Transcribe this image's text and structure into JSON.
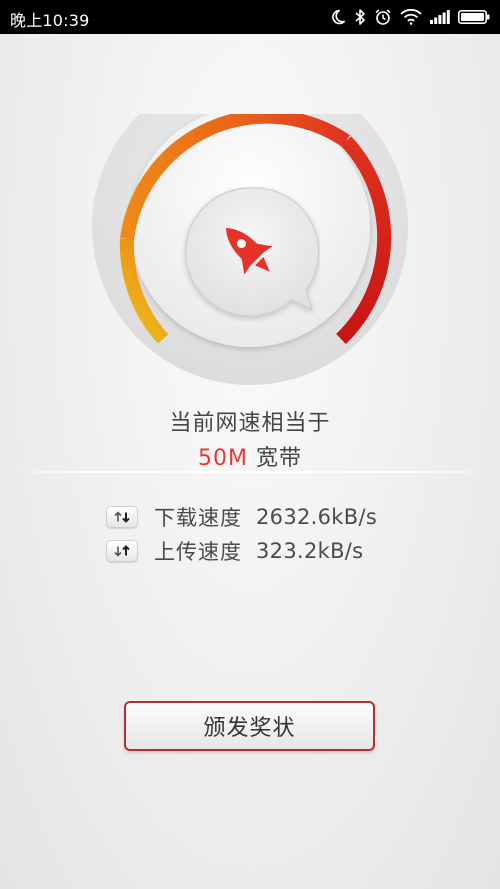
{
  "status_bar": {
    "time": "晚上10:39",
    "icons": [
      "moon-icon",
      "bluetooth-icon",
      "alarm-icon",
      "wifi-icon",
      "signal-icon",
      "battery-icon"
    ]
  },
  "gauge": {
    "icon": "rocket-icon",
    "arc_colors": [
      "#e8c51a",
      "#ef8a17",
      "#e0321e",
      "#c81414"
    ]
  },
  "result": {
    "caption": "当前网速相当于",
    "bandwidth_value": "50M",
    "bandwidth_unit": "宽带",
    "accent_color": "#e53935"
  },
  "stats": {
    "download_label": "下载速度",
    "download_value": "2632.6kB/s",
    "upload_label": "上传速度",
    "upload_value": "323.2kB/s"
  },
  "award_button": {
    "label": "颁发奖状"
  }
}
